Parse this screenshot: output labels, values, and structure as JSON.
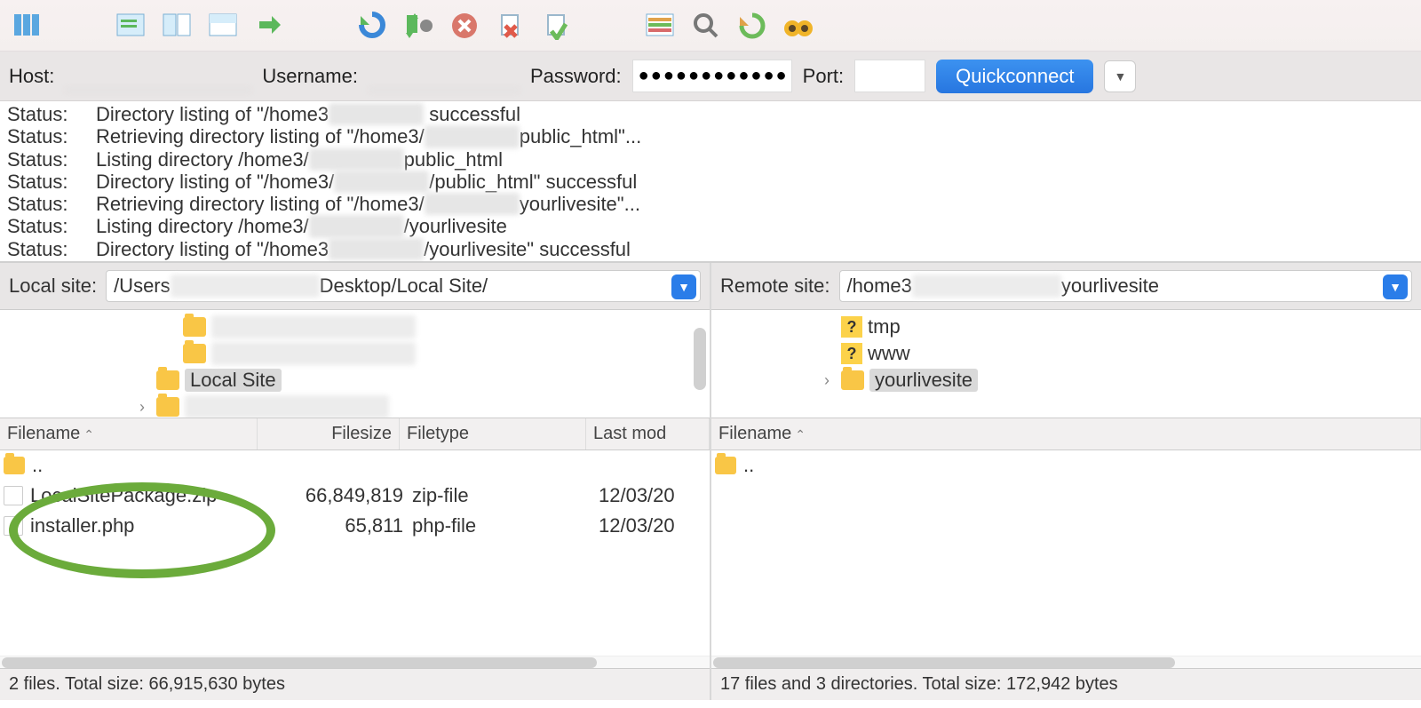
{
  "toolbar_icons": [
    "site-manager-icon",
    "toggle-message-icon",
    "toggle-local-tree-icon",
    "toggle-remote-tree-icon",
    "toggle-transfer-icon",
    "refresh-icon",
    "process-queue-icon",
    "cancel-icon",
    "disconnect-icon",
    "reconnect-icon",
    "directory-listing-icon",
    "search-icon",
    "sync-icon",
    "find-icon"
  ],
  "connect": {
    "host_label": "Host:",
    "username_label": "Username:",
    "password_label": "Password:",
    "port_label": "Port:",
    "password_dots": "●●●●●●●●●●●●",
    "quickconnect": "Quickconnect"
  },
  "log": [
    {
      "label": "Status:",
      "msg_pre": "Directory listing of \"/home3",
      "msg_blur": "xxxxxxxxx",
      "msg_post": " successful"
    },
    {
      "label": "Status:",
      "msg_pre": "Retrieving directory listing of \"/home3/",
      "msg_blur": "xxxxxxxxx",
      "msg_post": "public_html\"..."
    },
    {
      "label": "Status:",
      "msg_pre": "Listing directory /home3/",
      "msg_blur": "xxxxxxxxx",
      "msg_post": "public_html"
    },
    {
      "label": "Status:",
      "msg_pre": "Directory listing of \"/home3/",
      "msg_blur": "xxxxxxxxx",
      "msg_post": "/public_html\" successful"
    },
    {
      "label": "Status:",
      "msg_pre": "Retrieving directory listing of \"/home3/",
      "msg_blur": "xxxxxxxxx",
      "msg_post": "yourlivesite\"..."
    },
    {
      "label": "Status:",
      "msg_pre": "Listing directory /home3/",
      "msg_blur": "xxxxxxxxx",
      "msg_post": "/yourlivesite"
    },
    {
      "label": "Status:",
      "msg_pre": "Directory listing of \"/home3",
      "msg_blur": "xxxxxxxxx",
      "msg_post": "/yourlivesite\" successful"
    }
  ],
  "local": {
    "label": "Local site:",
    "path_pre": "/Users",
    "path_post": "Desktop/Local Site/",
    "tree": [
      {
        "indent": 180,
        "type": "fold",
        "blur": true
      },
      {
        "indent": 180,
        "type": "fold",
        "blur": true
      },
      {
        "indent": 150,
        "type": "fold",
        "label": "Local Site",
        "sel": true
      },
      {
        "indent": 150,
        "type": "fold",
        "blur": true,
        "expand": true
      }
    ],
    "cols": {
      "name": "Filename",
      "size": "Filesize",
      "type": "Filetype",
      "mod": "Last mod"
    },
    "files": [
      {
        "name": "..",
        "folder": true
      },
      {
        "name": "LocalSitePackage.zip",
        "size": "66,849,819",
        "type": "zip-file",
        "mod": "12/03/20"
      },
      {
        "name": "installer.php",
        "size": "65,811",
        "type": "php-file",
        "mod": "12/03/20"
      }
    ],
    "status": "2 files. Total size: 66,915,630 bytes"
  },
  "remote": {
    "label": "Remote site:",
    "path_pre": "/home3",
    "path_post": "yourlivesite",
    "tree": [
      {
        "indent": 120,
        "type": "q",
        "label": "tmp"
      },
      {
        "indent": 120,
        "type": "q",
        "label": "www"
      },
      {
        "indent": 120,
        "type": "fold",
        "label": "yourlivesite",
        "sel": true,
        "expand": true
      }
    ],
    "cols": {
      "name": "Filename"
    },
    "files": [
      {
        "name": "..",
        "folder": true
      }
    ],
    "status": "17 files and 3 directories. Total size: 172,942 bytes"
  }
}
